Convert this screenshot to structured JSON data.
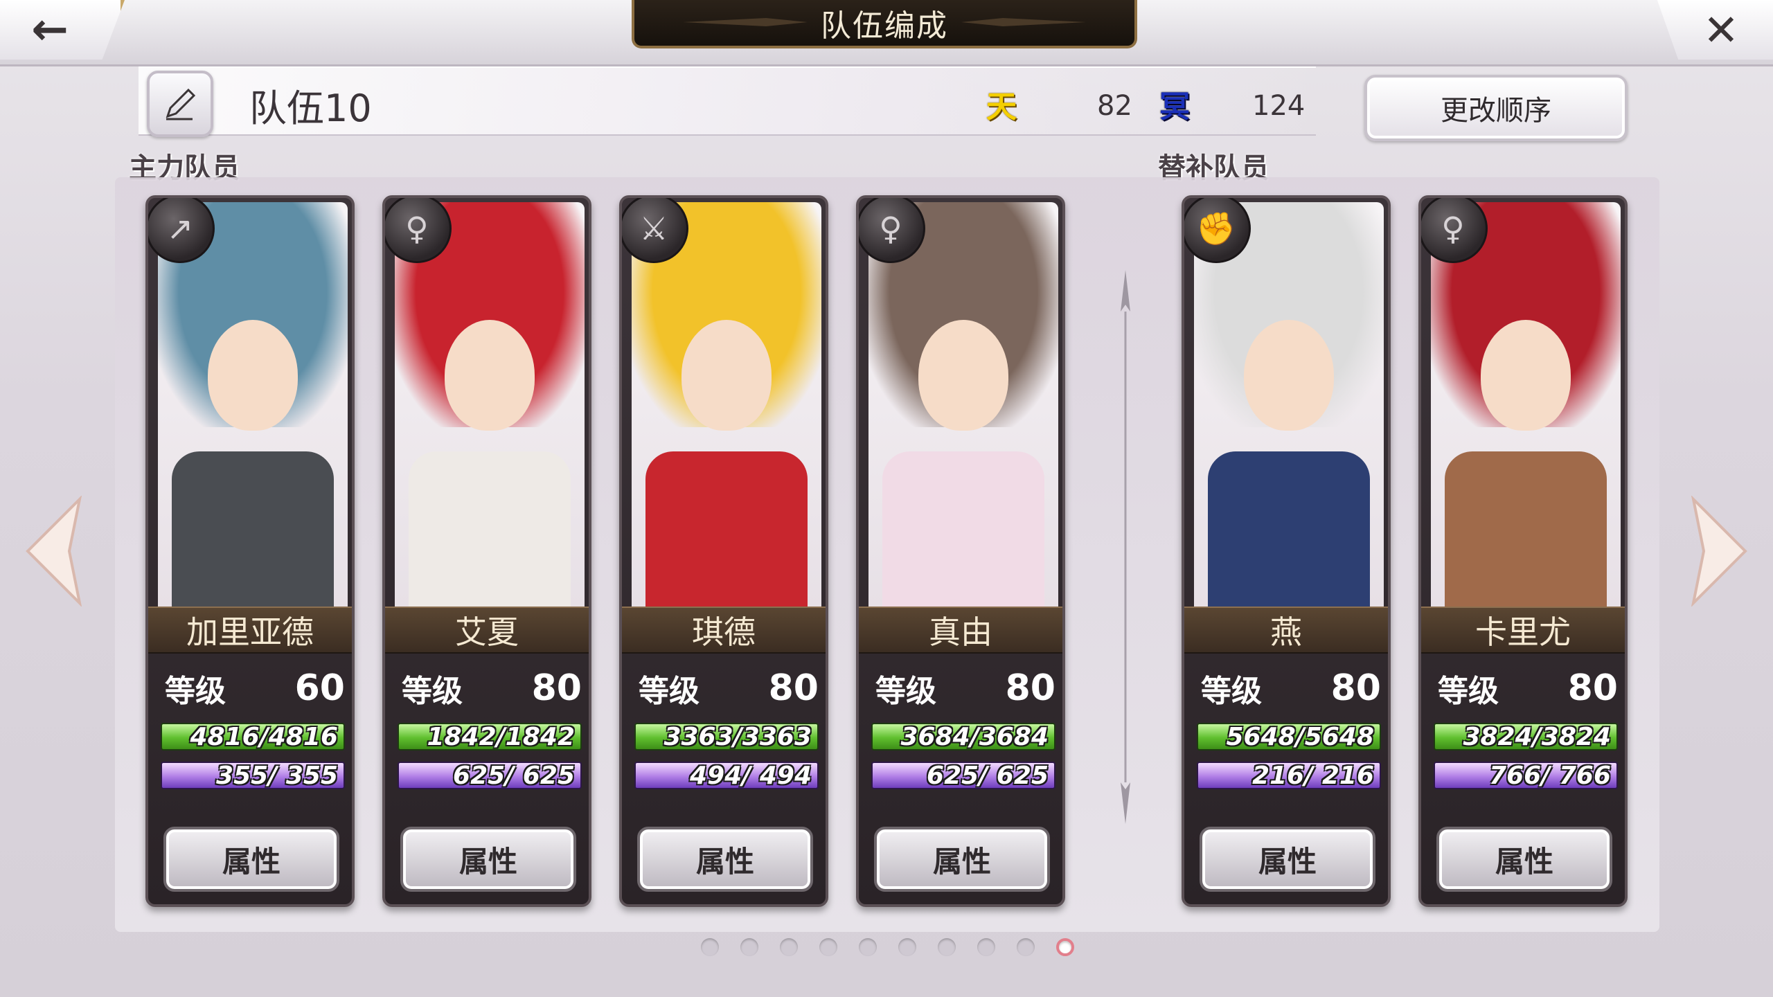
{
  "header": {
    "title": "队伍编成",
    "back_icon": "back-arrow-icon",
    "close_icon": "close-icon"
  },
  "team": {
    "name": "队伍10",
    "sky_icon_text": "天",
    "sky_value": "82",
    "dark_icon_text": "冥",
    "dark_value": "124",
    "reorder_label": "更改顺序"
  },
  "sections": {
    "main_label": "主力队员",
    "sub_label": "替补队员"
  },
  "labels": {
    "level": "等级",
    "attr": "属性"
  },
  "main_members": [
    {
      "name": "加里亚德",
      "role_icon": "spear-icon",
      "level": "60",
      "hp": "4816/4816",
      "mp": "355/ 355",
      "hair": "#5f8ea6",
      "body": "#4a4d52"
    },
    {
      "name": "艾夏",
      "role_icon": "staff-icon",
      "level": "80",
      "hp": "1842/1842",
      "mp": "625/ 625",
      "hair": "#c8232e",
      "body": "#eeeae6"
    },
    {
      "name": "琪德",
      "role_icon": "sword-icon",
      "level": "80",
      "hp": "3363/3363",
      "mp": "494/ 494",
      "hair": "#f2c22a",
      "body": "#c8262e"
    },
    {
      "name": "真由",
      "role_icon": "staff-icon",
      "level": "80",
      "hp": "3684/3684",
      "mp": "625/ 625",
      "hair": "#7b665c",
      "body": "#f1dbe6"
    }
  ],
  "sub_members": [
    {
      "name": "燕",
      "role_icon": "fist-icon",
      "level": "80",
      "hp": "5648/5648",
      "mp": "216/ 216",
      "hair": "#dcdcdc",
      "body": "#2d3f72"
    },
    {
      "name": "卡里尤",
      "role_icon": "staff-icon",
      "level": "80",
      "hp": "3824/3824",
      "mp": "766/ 766",
      "hair": "#b21e2a",
      "body": "#a06a4a"
    }
  ],
  "pagination": {
    "total": 10,
    "active": 10
  }
}
